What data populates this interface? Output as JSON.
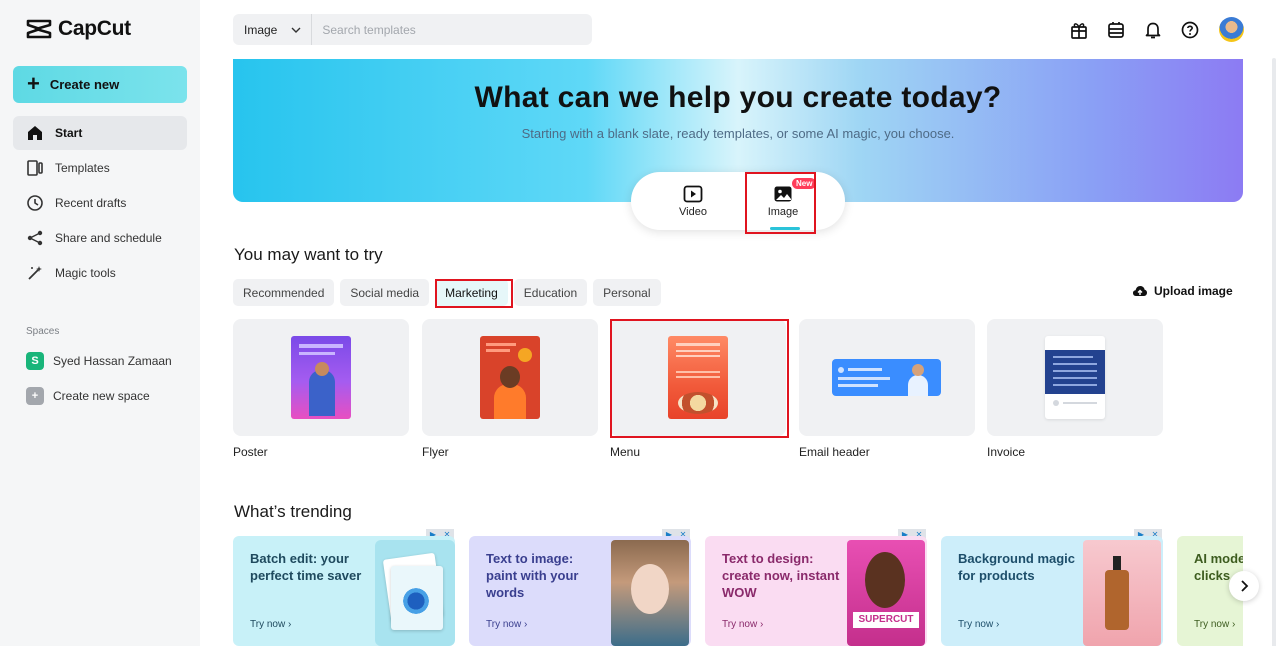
{
  "app": {
    "brand": "CapCut"
  },
  "sidebar": {
    "create_label": "Create new",
    "items": [
      {
        "label": "Start",
        "icon": "home-icon"
      },
      {
        "label": "Templates",
        "icon": "templates-icon"
      },
      {
        "label": "Recent drafts",
        "icon": "clock-icon"
      },
      {
        "label": "Share and schedule",
        "icon": "share-icon"
      },
      {
        "label": "Magic tools",
        "icon": "magic-wand-icon"
      }
    ],
    "spaces_label": "Spaces",
    "spaces": [
      {
        "label": "Syed Hassan Zamaan",
        "badge": "S",
        "color": "#19b57a"
      },
      {
        "label": "Create new space",
        "badge": "+",
        "color": "#a3a7ad"
      }
    ]
  },
  "search": {
    "type": "Image",
    "placeholder": "Search templates"
  },
  "topbar": {
    "icons": [
      "gift-icon",
      "storage-icon",
      "bell-icon",
      "help-icon",
      "avatar"
    ]
  },
  "hero": {
    "title": "What can we help you create today?",
    "subtitle": "Starting with a blank slate, ready templates, or some AI magic, you choose.",
    "tabs": [
      {
        "label": "Video"
      },
      {
        "label": "Image",
        "badge": "New"
      }
    ]
  },
  "try_section": {
    "title": "You may want to try",
    "chips": [
      "Recommended",
      "Social media",
      "Marketing",
      "Education",
      "Personal"
    ],
    "active_chip": "Marketing",
    "upload_label": "Upload image",
    "cards": [
      {
        "label": "Poster"
      },
      {
        "label": "Flyer"
      },
      {
        "label": "Menu"
      },
      {
        "label": "Email header"
      },
      {
        "label": "Invoice"
      }
    ]
  },
  "trending": {
    "title": "What’s trending",
    "cards": [
      {
        "title": "Batch edit: your perfect time saver",
        "cta": "Try now ›",
        "color": "#c8f1f8",
        "text_color": "#1f4a5e"
      },
      {
        "title": "Text to image: paint with your words",
        "cta": "Try now ›",
        "color": "#dcdcfb",
        "text_color": "#3a3f8f"
      },
      {
        "title": "Text to design: create now, instant WOW",
        "cta": "Try now ›",
        "color": "#fadcf2",
        "text_color": "#8a2a6b"
      },
      {
        "title": "Background magic for products",
        "cta": "Try now ›",
        "color": "#cdeefa",
        "text_color": "#1d4e6a"
      },
      {
        "title": "AI model fashion clicks",
        "cta": "Try now ›",
        "color": "#e6f5d5",
        "text_color": "#3d5c1f"
      }
    ],
    "supercut_label": "SUPERCUT"
  },
  "colors": {
    "accent": "#2ac3d9",
    "highlight_box": "#e0141f",
    "badge_new": "#ff3d5a"
  }
}
